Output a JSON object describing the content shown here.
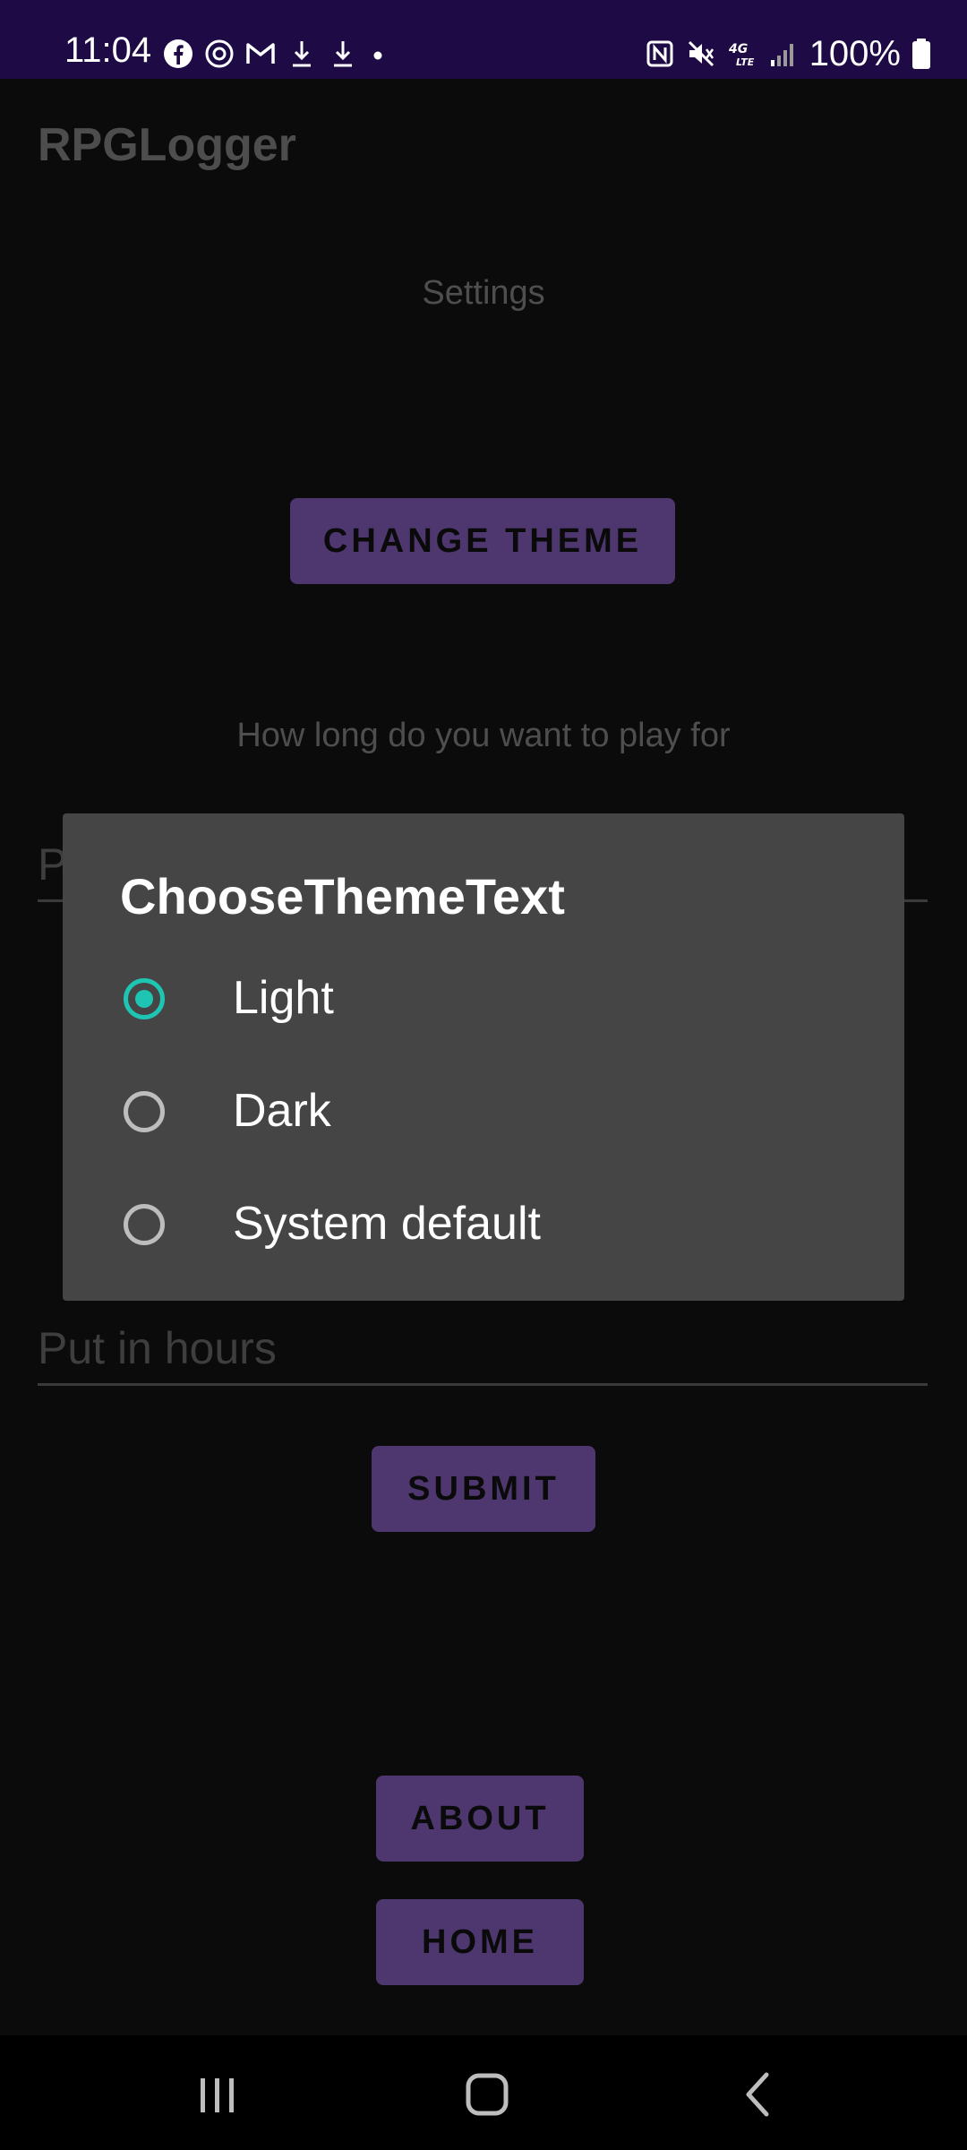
{
  "status_bar": {
    "time": "11:04",
    "left_icons": [
      "facebook-icon",
      "threads-icon",
      "gmail-icon",
      "download-icon",
      "download-icon",
      "dot-icon"
    ],
    "right_icons": [
      "nfc-icon",
      "mute-icon",
      "4g-lte-icon",
      "signal-icon"
    ],
    "battery_text": "100%",
    "background_color": "#1e0a45"
  },
  "app": {
    "title": "RPGLogger"
  },
  "settings": {
    "heading": "Settings",
    "change_theme_label": "CHANGE THEME",
    "play_question": "How long do you want to play for",
    "field_partial_text": "P",
    "hours_placeholder": "Put in hours",
    "submit_label": "SUBMIT",
    "about_label": "ABOUT",
    "home_label": "HOME",
    "button_color": "#4d376e"
  },
  "dialog": {
    "title": "ChooseThemeText",
    "options": [
      {
        "label": "Light",
        "selected": true
      },
      {
        "label": "Dark",
        "selected": false
      },
      {
        "label": "System default",
        "selected": false
      }
    ],
    "accent_color": "#1ec5b3"
  },
  "nav_bar": {
    "buttons": [
      "recents-icon",
      "home-icon",
      "back-icon"
    ]
  }
}
